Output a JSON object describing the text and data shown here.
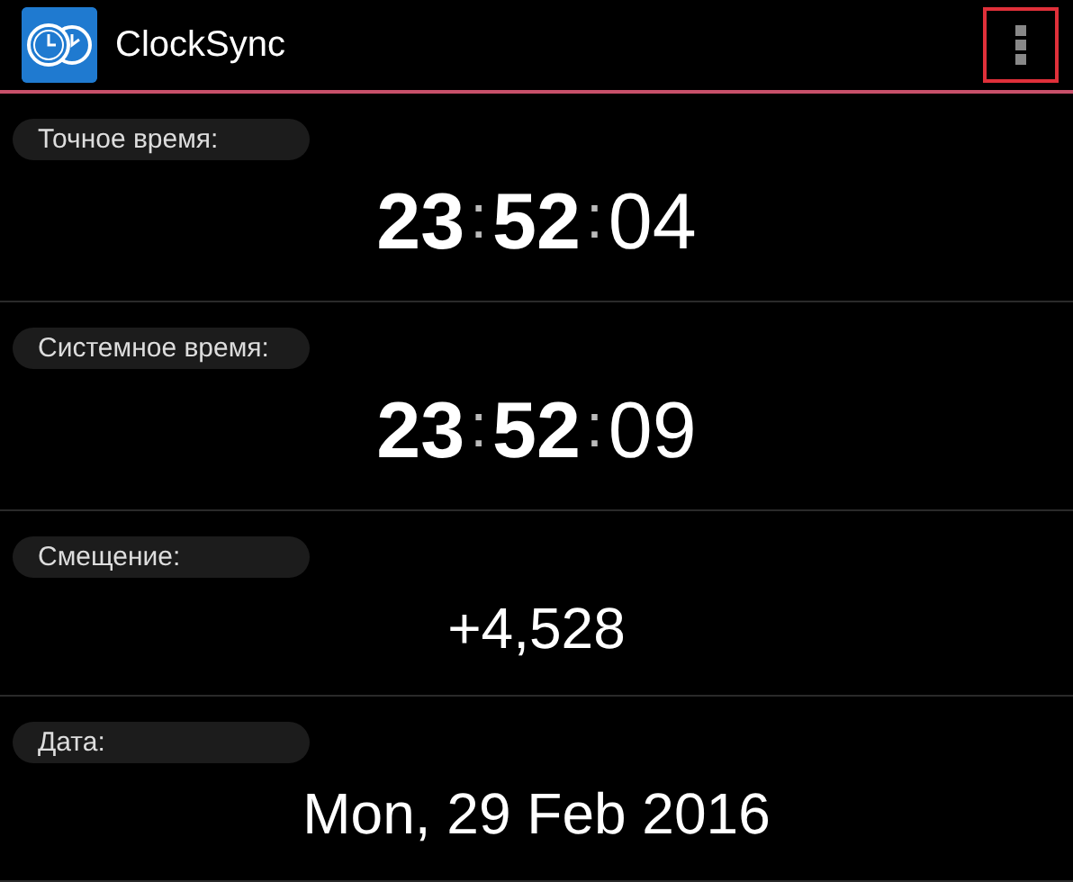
{
  "app_bar": {
    "title": "ClockSync",
    "menu_highlighted": true
  },
  "sections": [
    {
      "label": "Точное время:",
      "kind": "time",
      "hours": "23",
      "minutes": "52",
      "seconds": "04",
      "separator": ":"
    },
    {
      "label": "Системное время:",
      "kind": "time",
      "hours": "23",
      "minutes": "52",
      "seconds": "09",
      "separator": ":"
    },
    {
      "label": "Смещение:",
      "kind": "text",
      "value": "+4,528"
    },
    {
      "label": "Дата:",
      "kind": "text",
      "value": "Mon, 29 Feb 2016"
    }
  ]
}
